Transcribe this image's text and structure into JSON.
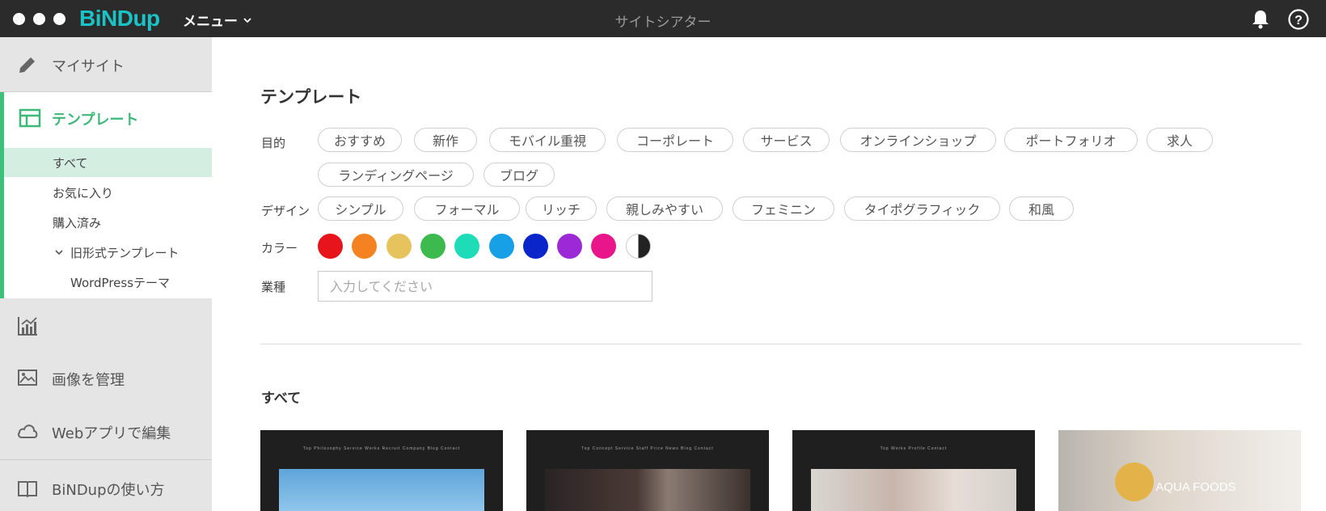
{
  "app": {
    "logo": "BiNDup",
    "menu_label": "メニュー",
    "title": "サイトシアター"
  },
  "sidebar": {
    "items": [
      {
        "label": "マイサイト",
        "icon": "pencil-icon"
      },
      {
        "label": "テンプレート",
        "icon": "template-icon"
      },
      {
        "label": "",
        "icon": "analytics-icon"
      },
      {
        "label": "画像を管理",
        "icon": "image-icon"
      },
      {
        "label": "Webアプリで編集",
        "icon": "cloud-icon"
      },
      {
        "label": "BiNDupの使い方",
        "icon": "book-icon"
      }
    ],
    "template_sub": [
      {
        "label": "すべて",
        "active": true
      },
      {
        "label": "お気に入り"
      },
      {
        "label": "購入済み"
      },
      {
        "label": "旧形式テンプレート"
      },
      {
        "label": "WordPressテーマ"
      }
    ]
  },
  "main": {
    "title": "テンプレート",
    "purpose_label": "目的",
    "purpose_tags": [
      "おすすめ",
      "新作",
      "モバイル重視",
      "コーポレート",
      "サービス",
      "オンラインショップ",
      "ポートフォリオ",
      "求人",
      "ランディングページ",
      "ブログ"
    ],
    "design_label": "デザイン",
    "design_tags": [
      "シンプル",
      "フォーマル",
      "リッチ",
      "親しみやすい",
      "フェミニン",
      "タイポグラフィック",
      "和風"
    ],
    "color_label": "カラー",
    "colors": [
      "#e8141b",
      "#f58220",
      "#e6c35c",
      "#3dba4e",
      "#1fdcb9",
      "#18a0e6",
      "#0a25c9",
      "#9b2ad6",
      "#e8168a",
      "mono"
    ],
    "industry_label": "業種",
    "industry_placeholder": "入力してください",
    "section_title": "すべて",
    "cards": [
      {
        "nav": "Top  Philosophy  Service  Works  Recruit  Company  Blog  Contact"
      },
      {
        "nav": "Top  Concept  Service  Staff  Price  News  Blog  Contact"
      },
      {
        "nav": "Top  Works  Profile  Contact"
      },
      {
        "title": "AQUA FOODS"
      }
    ]
  }
}
